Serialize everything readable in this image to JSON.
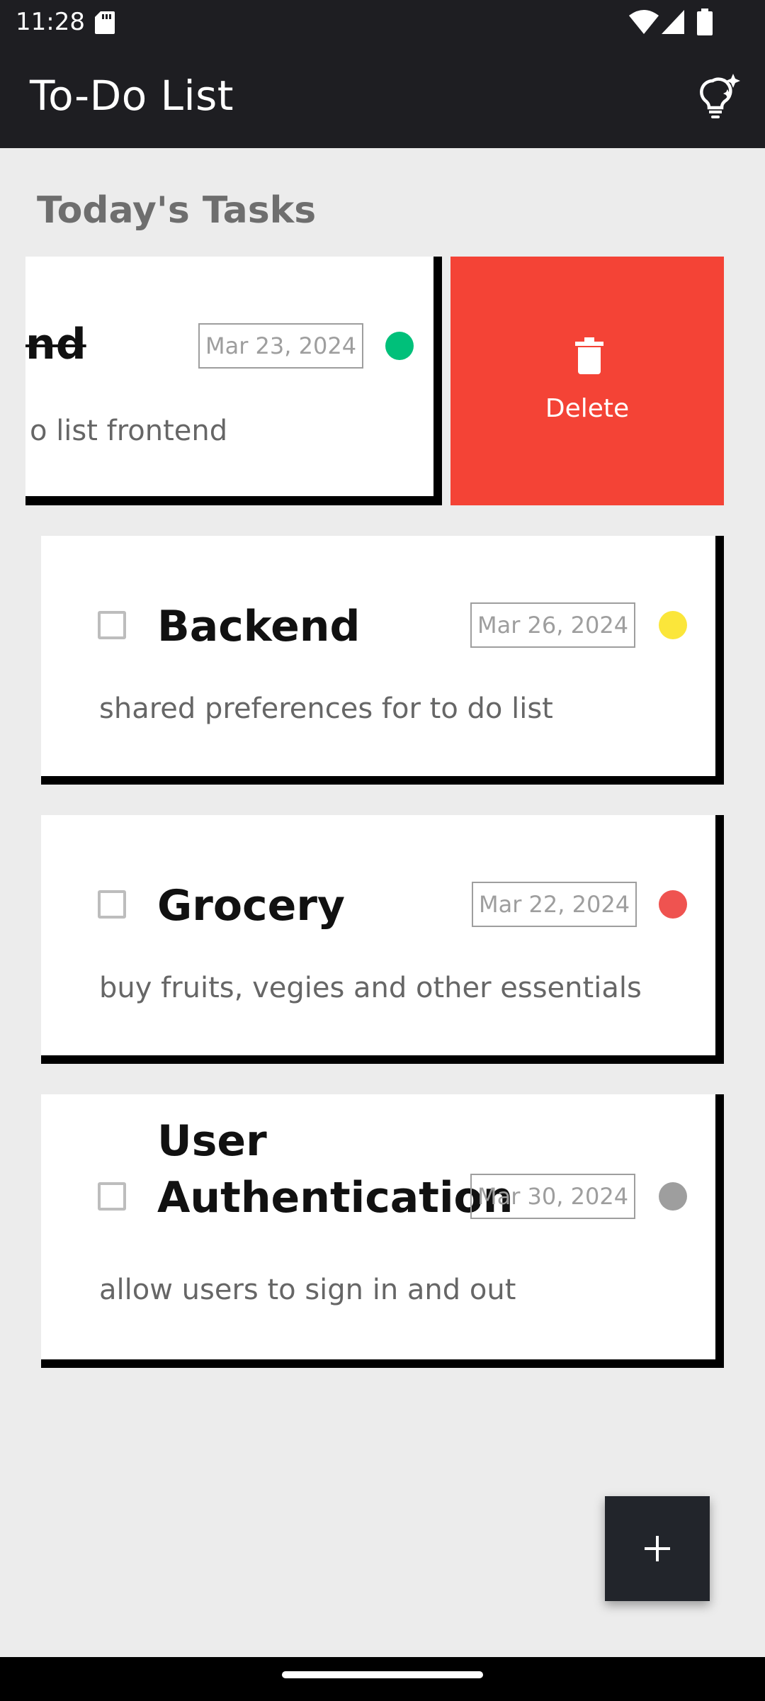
{
  "status_bar": {
    "time": "11:28"
  },
  "app_bar": {
    "title": "To-Do List"
  },
  "section": {
    "title": "Today's Tasks"
  },
  "swiped_task": {
    "title": "Frontend",
    "visible_title_fragment": "nd",
    "date": "Mar 23, 2024",
    "description": "to do list frontend",
    "visible_description_fragment": "o list frontend",
    "priority_color": "#00c07a",
    "completed": true,
    "delete_label": "Delete",
    "delete_color": "#f44336"
  },
  "tasks": [
    {
      "title": "Backend",
      "date": "Mar 26, 2024",
      "description": "shared preferences for to do list",
      "priority_color": "#fbe63a",
      "checked": false
    },
    {
      "title": "Grocery",
      "date": "Mar 22, 2024",
      "description": "buy fruits, vegies and other essentials",
      "priority_color": "#ef5350",
      "checked": false
    },
    {
      "title_line1": "User",
      "title_line2": "Authentication",
      "date": "Mar 30, 2024",
      "description": "allow users to sign in and out",
      "priority_color": "#9e9e9e",
      "checked": false
    }
  ],
  "fab": {
    "icon": "plus-icon"
  },
  "icons": {
    "status": [
      "sd-card-icon",
      "wifi-icon",
      "cell-signal-icon",
      "battery-icon"
    ],
    "app_bar_action": "lightbulb-sparkle-icon",
    "delete": "trash-icon"
  }
}
